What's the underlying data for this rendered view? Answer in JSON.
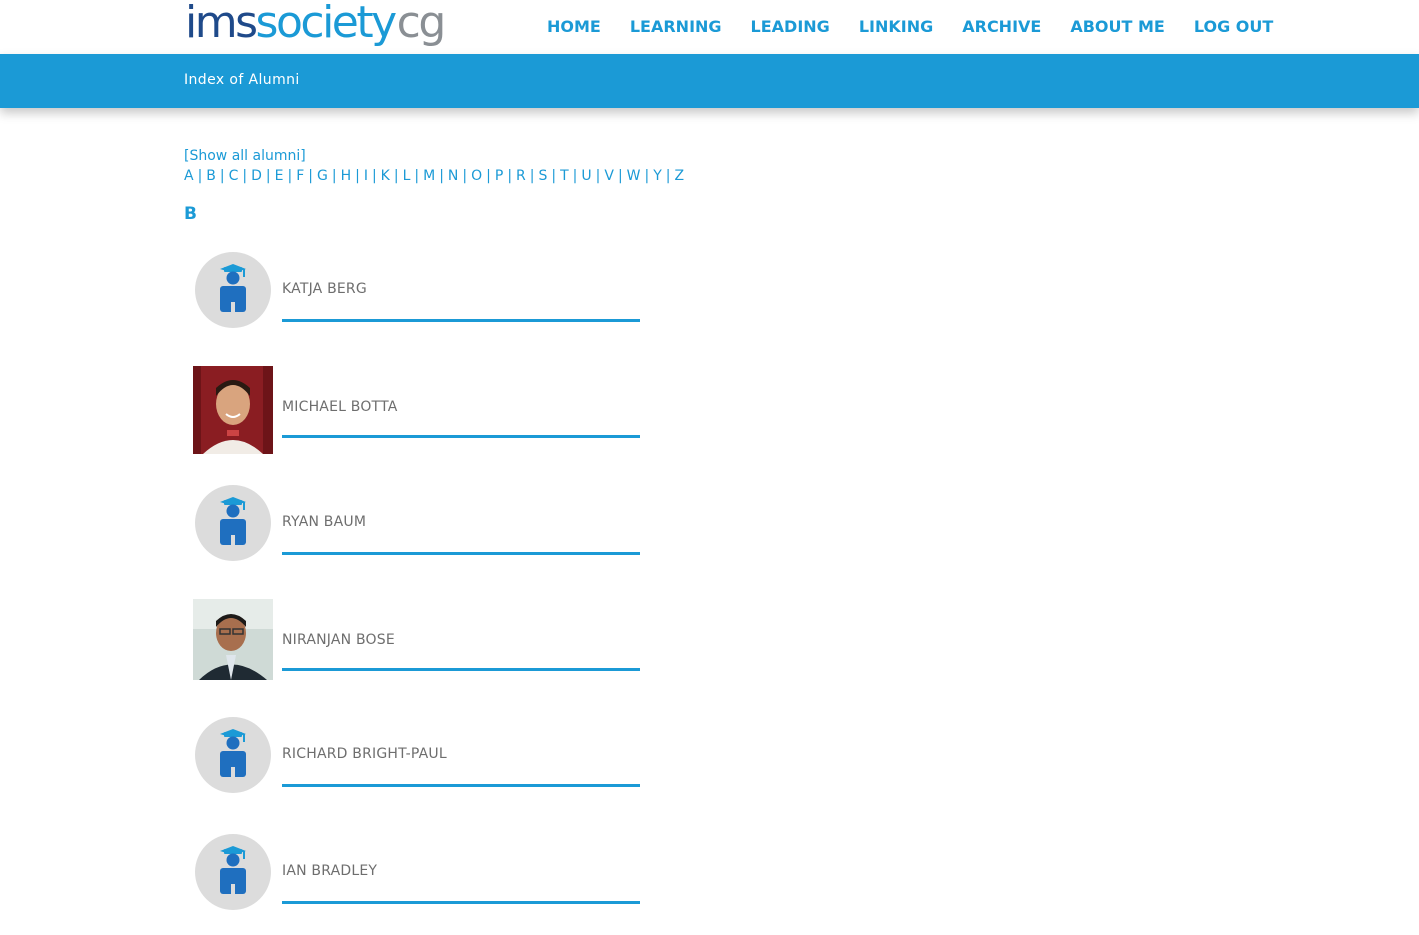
{
  "header": {
    "logo": {
      "part1": "ims",
      "part2": "ociety",
      "part3": "cg",
      "s": "s"
    },
    "nav": [
      "HOME",
      "LEARNING",
      "LEADING",
      "LINKING",
      "ARCHIVE",
      "ABOUT ME",
      "LOG OUT"
    ]
  },
  "band": {
    "title": "Index of Alumni"
  },
  "filters": {
    "show_all": "[Show all alumni]",
    "letters": [
      "A",
      "B",
      "C",
      "D",
      "E",
      "F",
      "G",
      "H",
      "I",
      "K",
      "L",
      "M",
      "N",
      "O",
      "P",
      "R",
      "S",
      "T",
      "U",
      "V",
      "W",
      "Y",
      "Z"
    ]
  },
  "section": {
    "letter": "B"
  },
  "alumni": [
    {
      "name": "KATJA BERG",
      "avatar": "placeholder-graduate-icon"
    },
    {
      "name": "MICHAEL BOTTA",
      "avatar": "photo"
    },
    {
      "name": "RYAN BAUM",
      "avatar": "placeholder-graduate-icon"
    },
    {
      "name": "NIRANJAN BOSE",
      "avatar": "photo"
    },
    {
      "name": "RICHARD BRIGHT-PAUL",
      "avatar": "placeholder-graduate-icon"
    },
    {
      "name": "IAN BRADLEY",
      "avatar": "placeholder-graduate-icon"
    }
  ],
  "colors": {
    "accent": "#1b9ad6",
    "logo_dark": "#1f4a8a",
    "logo_grey": "#8a8f94",
    "name_text": "#6e6e6e",
    "avatar_bg": "#dcdcdc"
  }
}
